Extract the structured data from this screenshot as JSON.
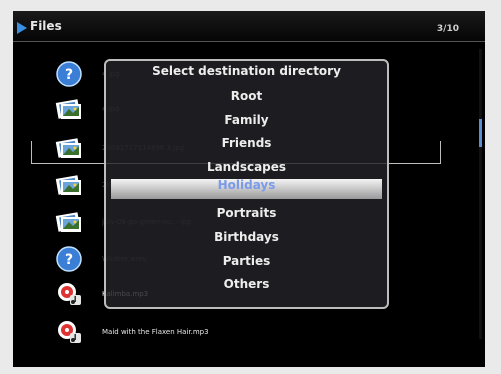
{
  "header": {
    "title": "Files",
    "page_indicator": "3/10"
  },
  "files": [
    {
      "name": "4.jpg",
      "icon": "unknown-file-icon"
    },
    {
      "name": "4.jpg",
      "icon": "photo-icon"
    },
    {
      "name": "20091717114896 3.jpg",
      "icon": "photo-icon"
    },
    {
      "name": "20090608418.jpg",
      "icon": "photo-icon"
    },
    {
      "name": "july-09-go-green-no...-ipg",
      "icon": "photo-icon"
    },
    {
      "name": "Wildlife.wmv",
      "icon": "unknown-file-icon"
    },
    {
      "name": "Kalimba.mp3",
      "icon": "music-file-icon"
    },
    {
      "name": "Maid with the Flaxen Hair.mp3",
      "icon": "music-file-icon"
    }
  ],
  "dialog": {
    "title": "Select destination directory",
    "options": [
      "Root",
      "Family",
      "Friends",
      "Landscapes",
      "Holidays",
      "Portraits",
      "Birthdays",
      "Parties",
      "Others"
    ],
    "selected": "Holidays"
  }
}
